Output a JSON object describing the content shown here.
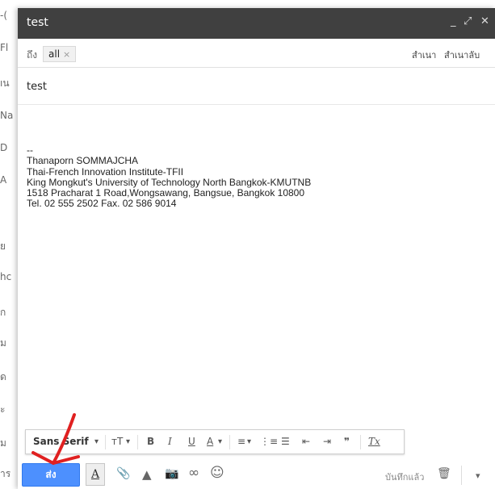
{
  "background": {
    "fragments": [
      "-(",
      "Fl",
      "ıน",
      "Na",
      "D",
      "A",
      "ย",
      "hc",
      "ุก",
      "ม",
      "ด",
      "ะ",
      "ม",
      "าร"
    ]
  },
  "compose": {
    "title": "test",
    "controls": {
      "minimize": "_",
      "popout": "⤢",
      "close": "✕"
    },
    "to": {
      "label": "ถึง",
      "recipient": "all",
      "remove": "×"
    },
    "cc_label": "สำเนา",
    "bcc_label": "สำเนาลับ",
    "subject": "test",
    "body_lines": [
      "--",
      "Thanaporn SOMMAJCHA",
      "Thai-French Innovation Institute-TFII",
      "King Mongkut's University of Technology North Bangkok-KMUTNB",
      "1518  Pracharat 1 Road,Wongsawang, Bangsue, Bangkok 10800",
      "Tel. 02 555 2502 Fax. 02 586 9014"
    ]
  },
  "format_toolbar": {
    "font": "Sans Serif",
    "dropdown": "▾",
    "size": "ᴛT",
    "bold": "B",
    "italic": "I",
    "underline": "U",
    "text_color": "A",
    "align": "≡",
    "numbered": "⋮≡",
    "bulleted": "☰",
    "indent_less": "⇤",
    "indent_more": "⇥",
    "quote": "❞",
    "clear": "Tx"
  },
  "actions": {
    "send": "ส่ง",
    "format_toggle": "A",
    "attach": "📎",
    "drive": "▲",
    "photo": "📷",
    "link": "∞",
    "emoji": "☺",
    "saved": "บันทึกแล้ว",
    "discard": "🗑",
    "more": "▾"
  },
  "colors": {
    "titlebar": "#404040",
    "send": "#4d90fe",
    "annotation_arrow": "#e02020"
  }
}
